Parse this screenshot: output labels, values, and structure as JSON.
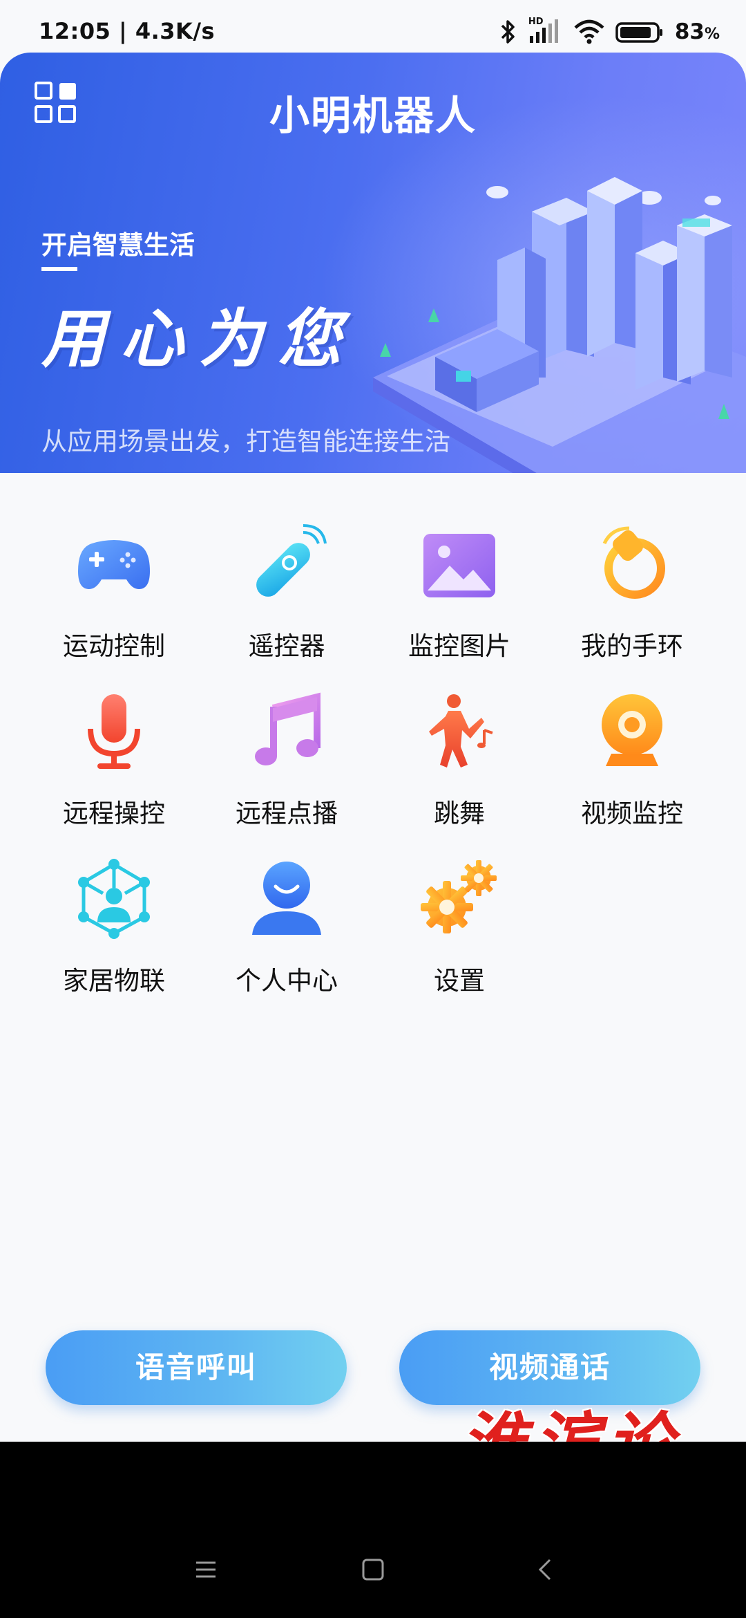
{
  "status_bar": {
    "time": "12:05 | 4.3K/s",
    "hd": "HD",
    "battery": "83",
    "battery_unit": "%"
  },
  "header": {
    "title": "小明机器人"
  },
  "banner": {
    "subtitle": "开启智慧生活",
    "slogan": "用心为您",
    "description": "从应用场景出发，打造智能连接生活"
  },
  "features": [
    {
      "label": "运动控制",
      "icon": "gamepad-icon"
    },
    {
      "label": "遥控器",
      "icon": "remote-control-icon"
    },
    {
      "label": "监控图片",
      "icon": "picture-icon"
    },
    {
      "label": "我的手环",
      "icon": "wristband-icon"
    },
    {
      "label": "远程操控",
      "icon": "microphone-icon"
    },
    {
      "label": "远程点播",
      "icon": "music-note-icon"
    },
    {
      "label": "跳舞",
      "icon": "dancer-icon"
    },
    {
      "label": "视频监控",
      "icon": "webcam-icon"
    },
    {
      "label": "家居物联",
      "icon": "network-icon"
    },
    {
      "label": "个人中心",
      "icon": "person-icon"
    },
    {
      "label": "设置",
      "icon": "gears-icon"
    }
  ],
  "actions": {
    "voice_call": "语音呼叫",
    "video_call": "视频通话"
  },
  "watermark": "淮滨论坛",
  "colors": {
    "banner_start": "#2f5fe3",
    "banner_end": "#7b86fb",
    "button_start": "#4a9df4",
    "button_end": "#72d0f0",
    "watermark": "#e0201d"
  }
}
